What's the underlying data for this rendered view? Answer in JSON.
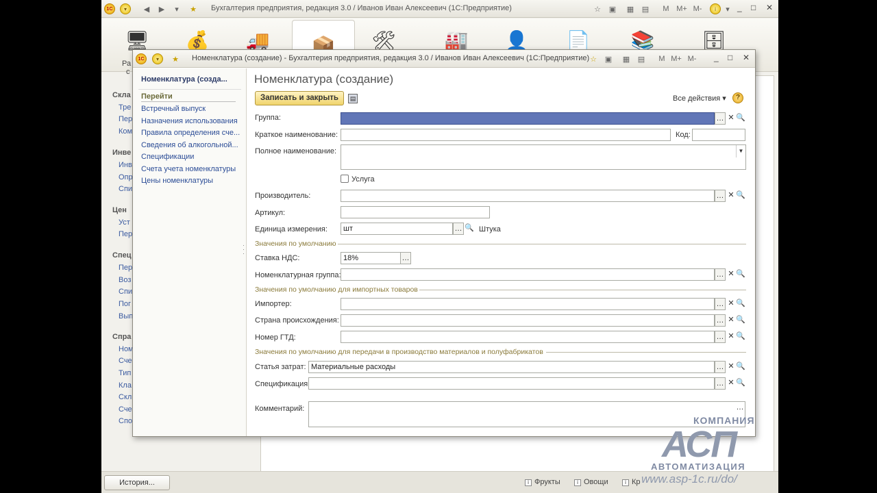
{
  "main_window": {
    "title": "Бухгалтерия предприятия, редакция 3.0 / Иванов Иван Алексеевич  (1С:Предприятие)",
    "logo_text": "1C",
    "toolbar_right": [
      "M",
      "M+",
      "M-"
    ]
  },
  "left_panel": {
    "partial_labels": [
      "Ра",
      "с",
      "Скла",
      "Тре",
      "Пер",
      "Ком",
      "Инве",
      "Инв",
      "Опр",
      "Спи",
      "Цен",
      "Уст",
      "Пер",
      "Спец",
      "Пер",
      "Воз",
      "Спи",
      "Пог",
      "Вып",
      "Спра",
      "Ном",
      "Сче",
      "Тип",
      "Кла",
      "Скл",
      "Сче",
      "Спо"
    ]
  },
  "status_bar": {
    "history_label": "История...",
    "items": [
      "Фрукты",
      "Овощи",
      "Кр"
    ]
  },
  "dialog": {
    "title": "Номенклатура (создание) - Бухгалтерия предприятия, редакция 3.0 / Иванов Иван Алексеевич  (1С:Предприятие)",
    "toolbar_right": [
      "M",
      "M+",
      "M-"
    ],
    "nav": {
      "title": "Номенклатура (созда...",
      "goto_label": "Перейти",
      "links": [
        "Встречный выпуск",
        "Назначения использования",
        "Правила определения сче...",
        "Сведения об алкогольной...",
        "Спецификации",
        "Счета учета номенклатуры",
        "Цены номенклатуры"
      ]
    },
    "form": {
      "title": "Номенклатура (создание)",
      "save_close_label": "Записать и закрыть",
      "all_actions_label": "Все действия ▾",
      "help_label": "?",
      "fields": {
        "group": {
          "label": "Группа:",
          "value": ""
        },
        "short_name": {
          "label": "Краткое наименование:",
          "value": ""
        },
        "code": {
          "label": "Код:",
          "value": ""
        },
        "full_name": {
          "label": "Полное наименование:",
          "value": ""
        },
        "service": {
          "label": "Услуга",
          "checked": false
        },
        "manufacturer": {
          "label": "Производитель:",
          "value": ""
        },
        "article": {
          "label": "Артикул:",
          "value": ""
        },
        "unit": {
          "label": "Единица измерения:",
          "value": "шт",
          "description": "Штука"
        },
        "vat_rate": {
          "label": "Ставка НДС:",
          "value": "18%"
        },
        "nomenclature_group": {
          "label": "Номенклатурная группа:",
          "value": ""
        },
        "importer": {
          "label": "Импортер:",
          "value": ""
        },
        "origin_country": {
          "label": "Страна происхождения:",
          "value": ""
        },
        "gtd_number": {
          "label": "Номер ГТД:",
          "value": ""
        },
        "cost_item": {
          "label": "Статья затрат:",
          "value": "Материальные расходы"
        },
        "specification": {
          "label": "Спецификация:",
          "value": ""
        },
        "comment": {
          "label": "Комментарий:",
          "value": ""
        }
      },
      "groups": {
        "defaults": "Значения по умолчанию",
        "import_defaults": "Значения по умолчанию для импортных товаров",
        "production_defaults": "Значения по умолчанию для передачи в производство материалов и полуфабрикатов"
      }
    }
  },
  "watermark": {
    "company": "КОМПАНИЯ",
    "logo": "АСП",
    "tagline": "АВТОМАТИЗАЦИЯ",
    "url": "www.asp-1c.ru/do/"
  },
  "colors": {
    "selected_field": "#6176b7",
    "link": "#2b4c96",
    "group_header": "#8a7a3a"
  }
}
